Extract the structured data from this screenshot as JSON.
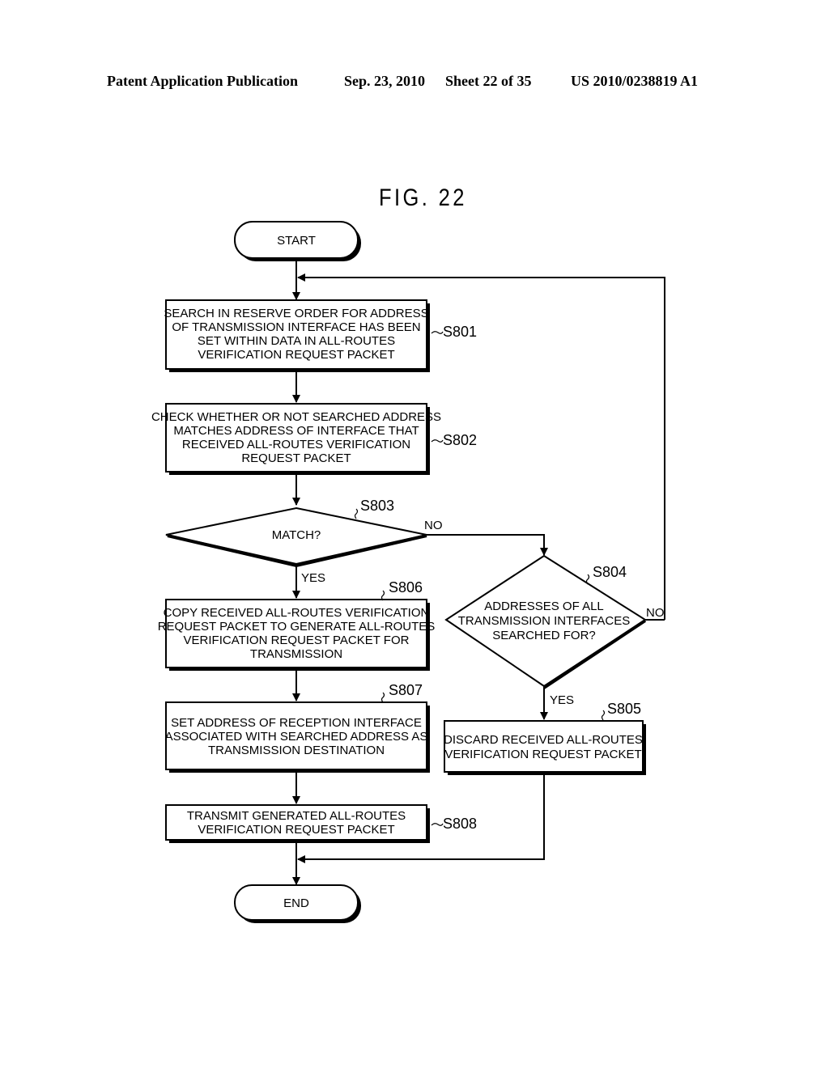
{
  "header": {
    "publication": "Patent Application Publication",
    "date": "Sep. 23, 2010",
    "sheet": "Sheet 22 of 35",
    "number": "US 2010/0238819 A1"
  },
  "figure": {
    "title": "FIG. 22"
  },
  "flowchart": {
    "start": "START",
    "end": "END",
    "steps": {
      "s801": {
        "id": "S801",
        "lines": [
          "SEARCH IN RESERVE ORDER FOR ADDRESS",
          "OF TRANSMISSION INTERFACE HAS BEEN",
          "SET WITHIN DATA IN ALL-ROUTES",
          "VERIFICATION REQUEST PACKET"
        ]
      },
      "s802": {
        "id": "S802",
        "lines": [
          "CHECK WHETHER OR NOT SEARCHED ADDRESS",
          "MATCHES ADDRESS OF INTERFACE THAT",
          "RECEIVED ALL-ROUTES VERIFICATION",
          "REQUEST PACKET"
        ]
      },
      "s803": {
        "id": "S803",
        "lines": [
          "MATCH?"
        ],
        "yes": "YES",
        "no": "NO"
      },
      "s804": {
        "id": "S804",
        "lines": [
          "ADDRESSES OF ALL",
          "TRANSMISSION INTERFACES",
          "SEARCHED FOR?"
        ],
        "yes": "YES",
        "no": "NO"
      },
      "s805": {
        "id": "S805",
        "lines": [
          "DISCARD RECEIVED ALL-ROUTES",
          "VERIFICATION REQUEST PACKET"
        ]
      },
      "s806": {
        "id": "S806",
        "lines": [
          "COPY RECEIVED ALL-ROUTES VERIFICATION",
          "REQUEST PACKET TO GENERATE ALL-ROUTES",
          "VERIFICATION REQUEST PACKET FOR",
          "TRANSMISSION"
        ]
      },
      "s807": {
        "id": "S807",
        "lines": [
          "SET ADDRESS OF RECEPTION INTERFACE",
          "ASSOCIATED WITH SEARCHED ADDRESS AS",
          "TRANSMISSION DESTINATION"
        ]
      },
      "s808": {
        "id": "S808",
        "lines": [
          "TRANSMIT GENERATED ALL-ROUTES",
          "VERIFICATION REQUEST PACKET"
        ]
      }
    }
  }
}
